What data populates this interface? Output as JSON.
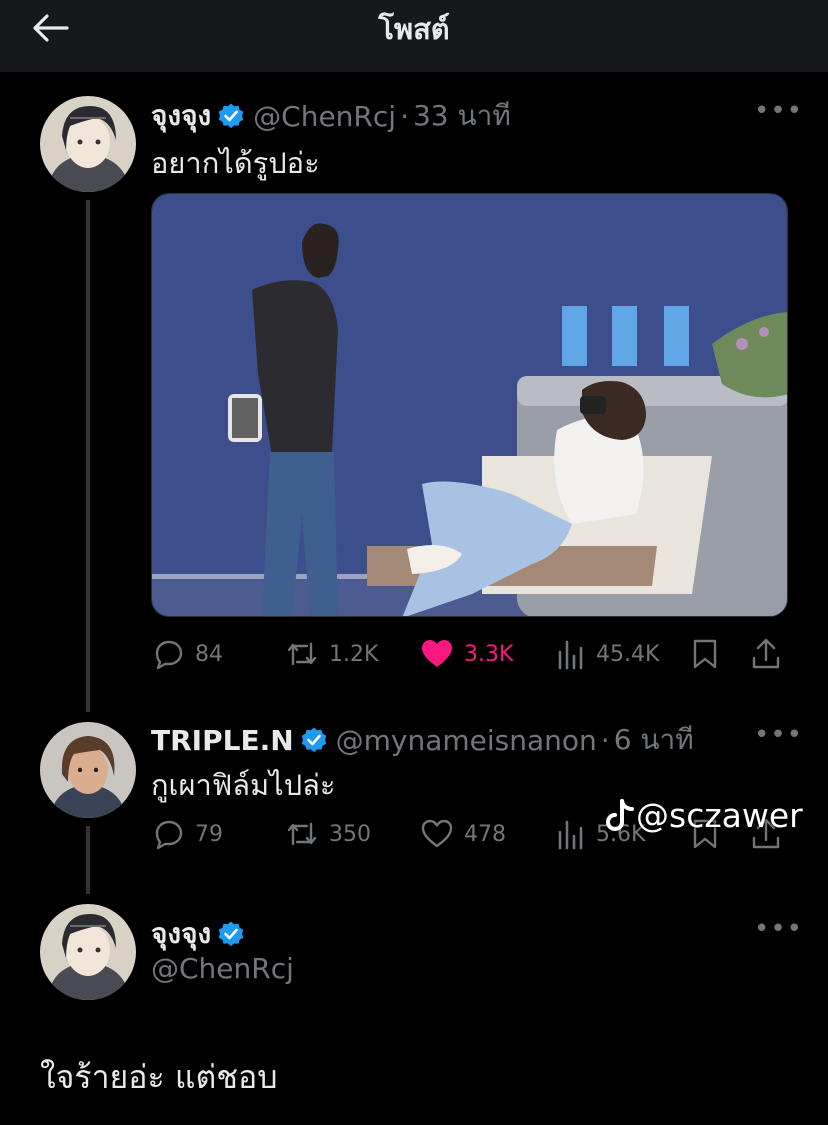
{
  "header": {
    "title": "โพสต์"
  },
  "tweets": [
    {
      "name": "จุงจุง",
      "handle": "@ChenRcj",
      "separator": "·",
      "time": "33 นาที",
      "text": "อยากได้รูปอ่ะ",
      "stats": {
        "replies": "84",
        "reposts": "1.2K",
        "likes": "3.3K",
        "views": "45.4K"
      }
    },
    {
      "name": "TRIPLE.N",
      "handle": "@mynameisnanon",
      "separator": "·",
      "time": "6 นาที",
      "text": "กูเผาฟิล์มไปล่ะ",
      "stats": {
        "replies": "79",
        "reposts": "350",
        "likes": "478",
        "views": "5.6K"
      }
    },
    {
      "name": "จุงจุง",
      "handle": "@ChenRcj",
      "text": "ใจร้ายอ่ะ แต่ชอบ"
    }
  ],
  "watermark": {
    "text": "@sczawer",
    "icon": "tiktok-icon"
  },
  "colors": {
    "background": "#000000",
    "verified": "#1d9bf0",
    "liked": "#f91880",
    "muted": "#71767b"
  }
}
